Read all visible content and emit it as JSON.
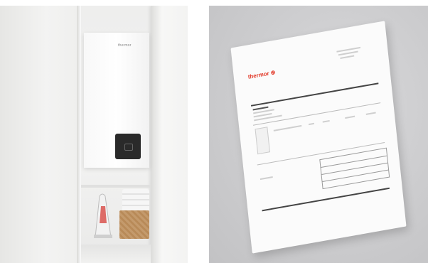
{
  "left_photo": {
    "heater_brand": "thermor"
  },
  "right_photo": {
    "logo_text": "thermor ⊕"
  },
  "colors": {
    "brand_red": "#e23a2a",
    "background_grey": "#cbcbcd"
  }
}
